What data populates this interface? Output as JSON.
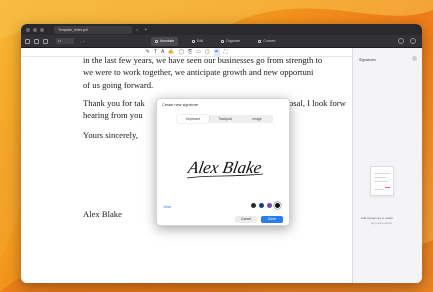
{
  "window": {
    "tab_title": "Template_letter.pdf",
    "new_tab": "+"
  },
  "toolbar": {
    "view_select": "Fit",
    "zoom_label": "- +",
    "modes": [
      {
        "label": "Annotate",
        "icon": "annotate-icon",
        "active": true
      },
      {
        "label": "Edit",
        "icon": "edit-icon",
        "active": false
      },
      {
        "label": "Organize",
        "icon": "organize-icon",
        "active": false
      },
      {
        "label": "Convert",
        "icon": "convert-icon",
        "active": false
      }
    ],
    "annotate_tools": [
      "✎",
      "T",
      "A",
      "✍",
      "◯",
      "⎘",
      "▭",
      "▢",
      "✒",
      "⛶"
    ]
  },
  "document": {
    "lines": [
      "in the last few years, we have seen our businesses go from strength to",
      "we were to work together, we anticipate growth and new opportuni",
      "of us going forward.",
      "Thank you for tak",
      "osal, I look forw",
      "hearing from you",
      "Yours sincerely,",
      "Alex Blake"
    ]
  },
  "dialog": {
    "title": "Create new signature",
    "segments": [
      {
        "label": "Keyboard",
        "active": true
      },
      {
        "label": "Trackpad",
        "active": false
      },
      {
        "label": "Image",
        "active": false
      }
    ],
    "signature_text": "Alex Blake",
    "clear_label": "Clear",
    "cancel_label": "Cancel",
    "done_label": "Done",
    "swatch_colors": [
      "#2c2c2e",
      "#1f3c8a",
      "#6d4bb8",
      "#111111"
    ],
    "selected_color": "#111111"
  },
  "sidebar": {
    "title": "Signatures",
    "caption_primary": "Add signatures to easily",
    "caption_secondary": "sign documents"
  },
  "colors": {
    "accent": "#2b7de9",
    "titlebar": "#2a2a2c"
  }
}
